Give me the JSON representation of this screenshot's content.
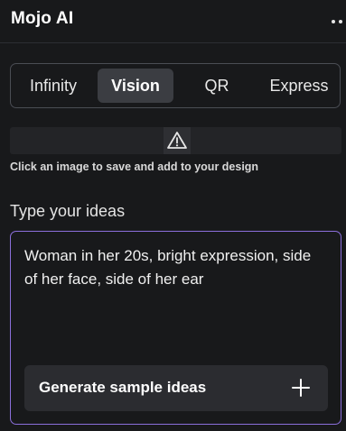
{
  "app": {
    "title": "Mojo AI",
    "more_icon": "more-horizontal-icon"
  },
  "tabs": [
    {
      "label": "Infinity",
      "active": false
    },
    {
      "label": "Vision",
      "active": true
    },
    {
      "label": "QR",
      "active": false
    },
    {
      "label": "Express",
      "active": false
    }
  ],
  "notice": {
    "icon": "warning-icon",
    "hint": "Click an image to save and add to your design"
  },
  "ideas": {
    "label": "Type your ideas",
    "value": "Woman in her 20s, bright expression, side of her face, side of her ear",
    "generate_label": "Generate sample ideas",
    "generate_icon": "plus-icon"
  },
  "colors": {
    "background": "#18191b",
    "accent_border": "#8b6fdb",
    "active_tab": "#3b3d42"
  }
}
